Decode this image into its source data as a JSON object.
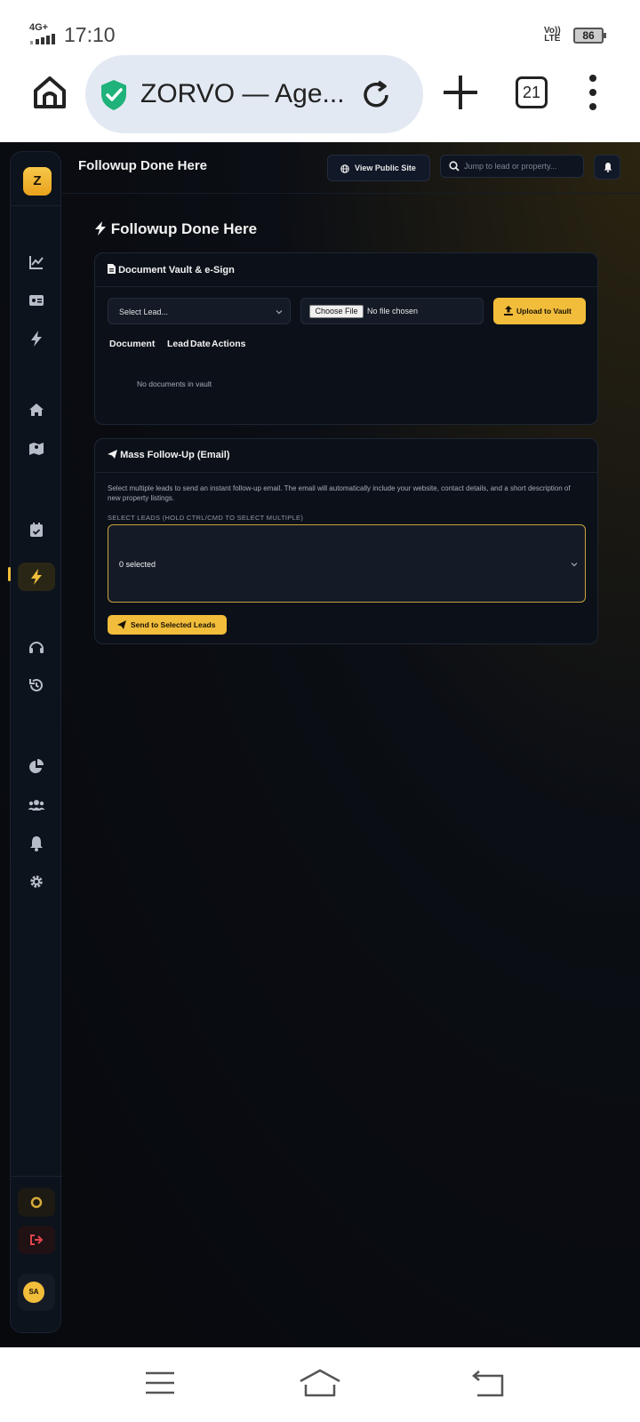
{
  "status_bar": {
    "network": "4G+",
    "time": "17:10",
    "volte_top": "Vo))",
    "volte_bottom": "LTE",
    "battery": "86"
  },
  "browser": {
    "url_title": "ZORVO — Age...",
    "tab_count": "21"
  },
  "app": {
    "logo_letter": "Z",
    "topbar_title": "Followup Done Here",
    "view_public_site": "View Public Site",
    "search_placeholder": "Jump to lead or property...",
    "page_heading": "Followup Done Here",
    "avatar_initials": "SA",
    "accent_color": "#f1bd3a",
    "vault": {
      "title": "Document Vault & e-Sign",
      "select_lead": "Select Lead...",
      "choose_file": "Choose File",
      "no_file": "No file chosen",
      "upload_label": "Upload to Vault",
      "columns": [
        "Document",
        "Lead",
        "Date",
        "Actions"
      ],
      "empty_text": "No documents in vault"
    },
    "mass": {
      "title": "Mass Follow-Up (Email)",
      "description": "Select multiple leads to send an instant follow-up email. The email will automatically include your website, contact details, and a short description of new property listings.",
      "select_label": "SELECT LEADS (HOLD CTRL/CMD TO SELECT MULTIPLE)",
      "selected_text": "0 selected",
      "send_label": "Send to Selected Leads"
    },
    "sidebar_icons": [
      "chart-line-icon",
      "id-card-icon",
      "bolt-icon",
      "home-icon",
      "map-icon",
      "calendar-check-icon",
      "bolt-icon",
      "headset-icon",
      "history-icon",
      "pie-chart-icon",
      "users-icon",
      "bell-icon",
      "gear-icon"
    ]
  }
}
